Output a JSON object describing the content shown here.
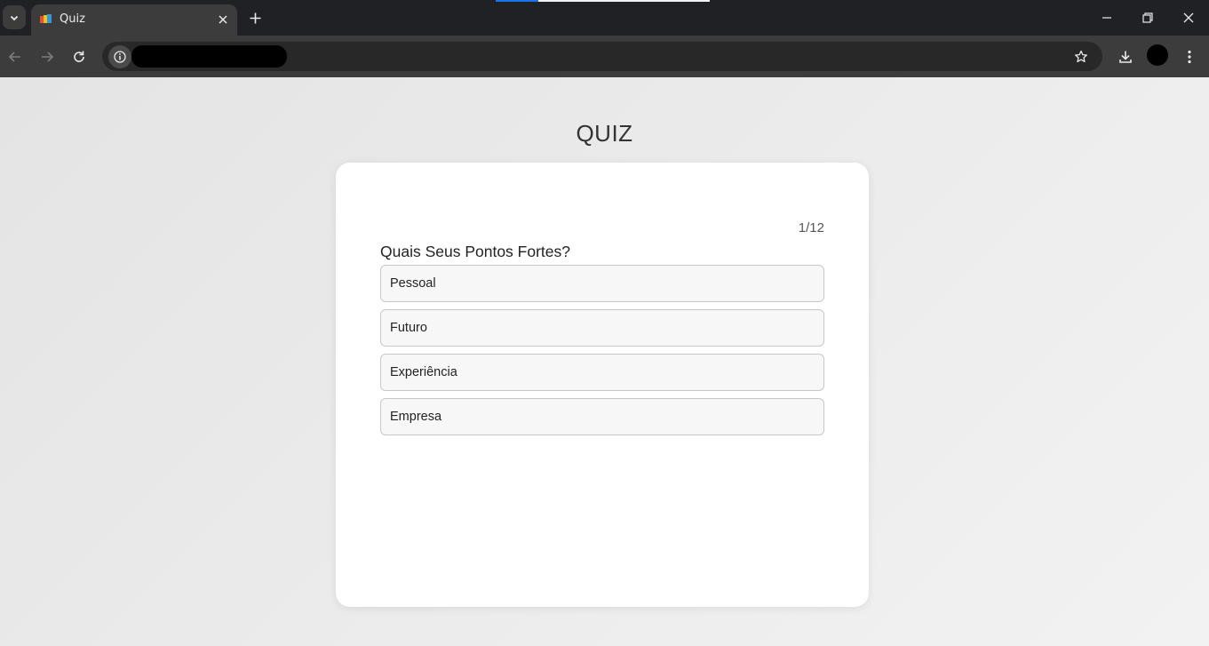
{
  "browser": {
    "tab_title": "Quiz",
    "icons": {
      "tab_list": "chevron-down-icon",
      "close_tab": "close-icon",
      "new_tab": "plus-icon",
      "minimize": "minimize-icon",
      "restore": "restore-icon",
      "close_window": "close-icon",
      "back": "arrow-left-icon",
      "forward": "arrow-right-icon",
      "reload": "reload-icon",
      "site_info": "info-icon",
      "bookmark": "star-icon",
      "download": "download-icon",
      "menu": "kebab-menu-icon"
    }
  },
  "page": {
    "heading": "QUIZ",
    "counter": "1/12",
    "question": "Quais Seus Pontos Fortes?",
    "options": [
      "Pessoal",
      "Futuro",
      "Experiência",
      "Empresa"
    ]
  }
}
